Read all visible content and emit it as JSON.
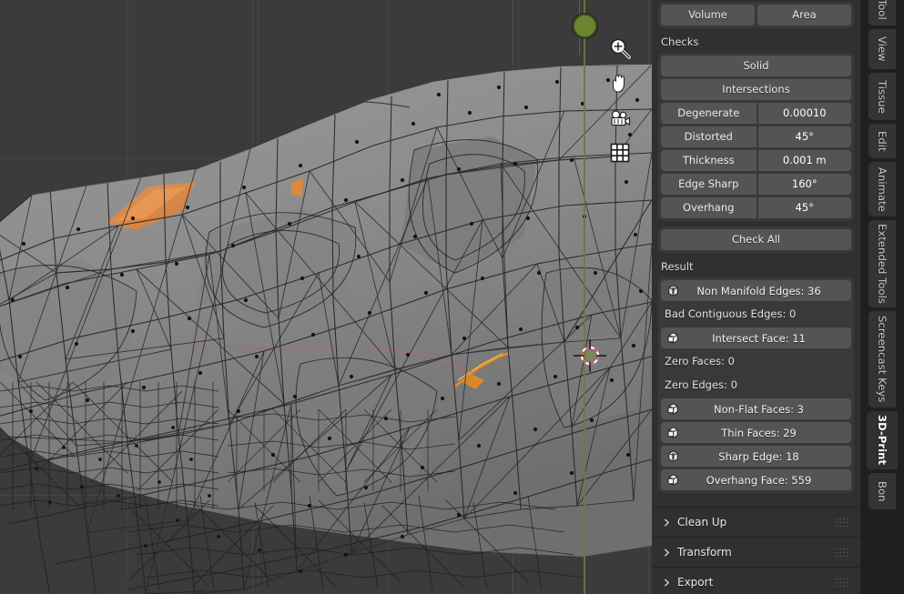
{
  "app": {
    "name": "Blender",
    "editor": "3D Viewport",
    "active_workspace_tab": "3D-Print"
  },
  "viewport": {
    "background_color": "#3b3b3b",
    "mesh_color": "#8c8c8c",
    "wireframe_color": "#1a1a1a",
    "selected_face_color": "#e08a35",
    "axis_line_color": "#6b7a3a",
    "cursor_color": "#d8566e",
    "grid_visible": true,
    "gizmos": [
      {
        "name": "zoom-gizmo",
        "icon": "magnifier-icon"
      },
      {
        "name": "pan-gizmo",
        "icon": "hand-icon"
      },
      {
        "name": "camera-view-gizmo",
        "icon": "camera-icon"
      },
      {
        "name": "toggle-perspective-gizmo",
        "icon": "grid-icon"
      }
    ]
  },
  "sidepanel": {
    "stats_row": {
      "volume_label": "Volume",
      "area_label": "Area"
    },
    "checks": {
      "section_label": "Checks",
      "solid_label": "Solid",
      "intersections_label": "Intersections",
      "params": [
        {
          "label": "Degenerate",
          "value": "0.00010"
        },
        {
          "label": "Distorted",
          "value": "45°"
        },
        {
          "label": "Thickness",
          "value": "0.001 m"
        },
        {
          "label": "Edge Sharp",
          "value": "160°"
        },
        {
          "label": "Overhang",
          "value": "45°"
        }
      ],
      "check_all_label": "Check All"
    },
    "result": {
      "section_label": "Result",
      "rows": [
        {
          "label": "Non Manifold Edges: 36",
          "icon": "edge-data-icon",
          "button": true,
          "count": 36
        },
        {
          "label": "Bad Contiguous Edges: 0",
          "icon": "",
          "button": false,
          "count": 0
        },
        {
          "label": "Intersect Face: 11",
          "icon": "face-data-icon",
          "button": true,
          "count": 11
        },
        {
          "label": "Zero Faces: 0",
          "icon": "",
          "button": false,
          "count": 0
        },
        {
          "label": "Zero Edges: 0",
          "icon": "",
          "button": false,
          "count": 0
        },
        {
          "label": "Non-Flat Faces: 3",
          "icon": "face-data-icon",
          "button": true,
          "count": 3
        },
        {
          "label": "Thin Faces: 29",
          "icon": "face-data-icon",
          "button": true,
          "count": 29
        },
        {
          "label": "Sharp Edge: 18",
          "icon": "edge-data-icon",
          "button": true,
          "count": 18
        },
        {
          "label": "Overhang Face: 559",
          "icon": "face-data-icon",
          "button": true,
          "count": 559
        }
      ]
    },
    "collapsed_panels": [
      {
        "label": "Clean Up",
        "expanded": false
      },
      {
        "label": "Transform",
        "expanded": false
      },
      {
        "label": "Export",
        "expanded": false
      }
    ]
  },
  "tabstrip": {
    "tabs": [
      {
        "label": "Tool",
        "active": false
      },
      {
        "label": "View",
        "active": false
      },
      {
        "label": "Tissue",
        "active": false
      },
      {
        "label": "Edit",
        "active": false
      },
      {
        "label": "Animate",
        "active": false
      },
      {
        "label": "Extended Tools",
        "active": false
      },
      {
        "label": "Screencast Keys",
        "active": false
      },
      {
        "label": "3D-Print",
        "active": true
      },
      {
        "label": "Bon",
        "active": false
      }
    ]
  }
}
